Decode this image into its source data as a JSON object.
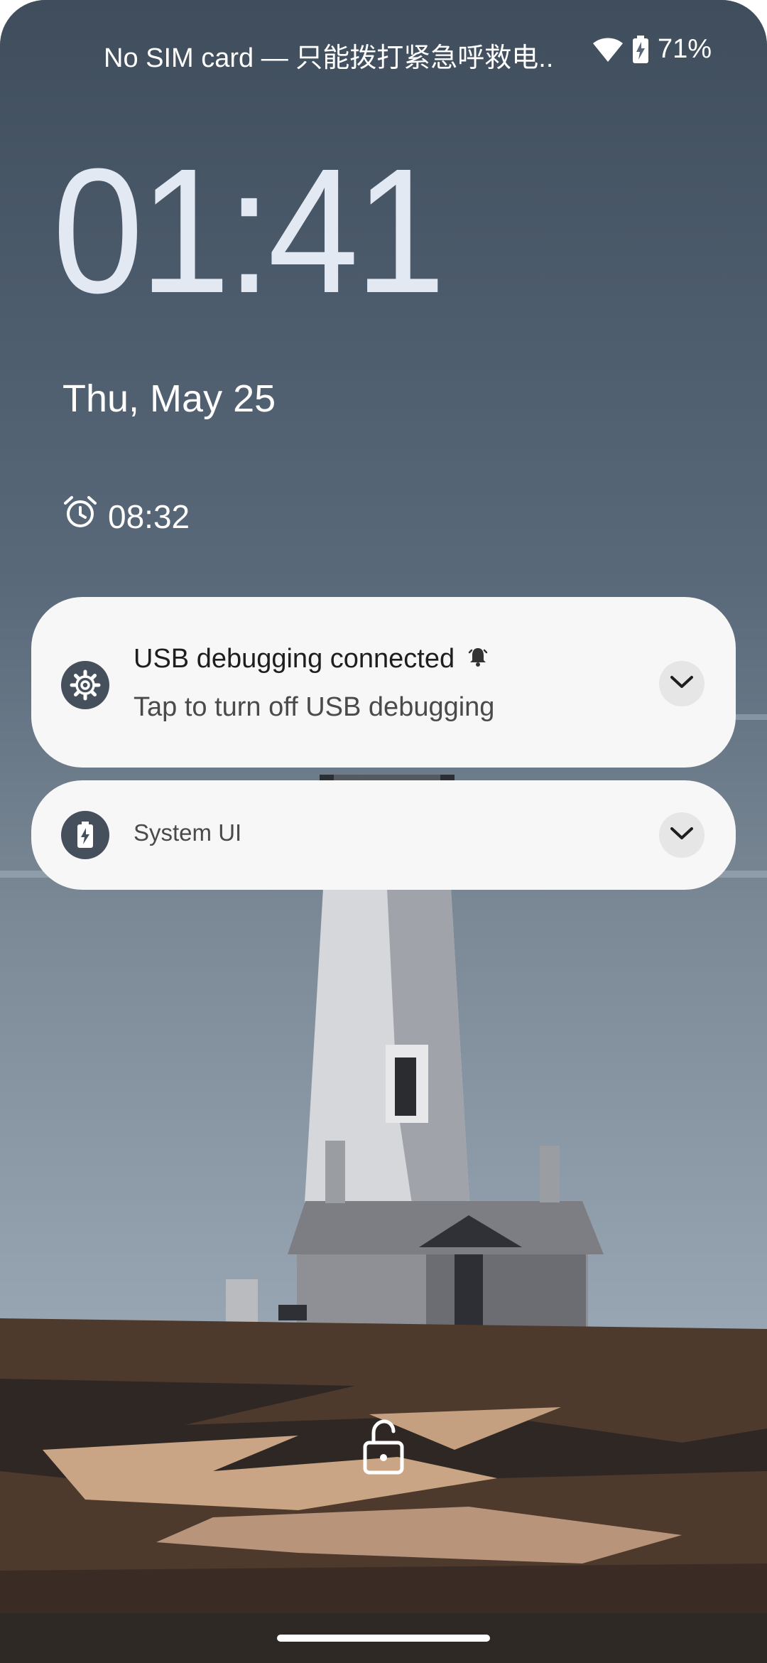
{
  "status_bar": {
    "carrier_text": "No SIM card — 只能拨打紧急呼救电..",
    "battery_percent": "71%",
    "icons": [
      "wifi-icon",
      "battery-charging-icon"
    ]
  },
  "lockscreen": {
    "time": "01:41",
    "date": "Thu, May 25",
    "alarm_time": "08:32",
    "alarm_icon": "alarm-clock-icon"
  },
  "notifications": [
    {
      "app_icon": "settings-gear-icon",
      "title": "USB debugging connected",
      "text": "Tap to turn off USB debugging",
      "alert_icon": "bell-icon"
    },
    {
      "app_icon": "battery-charging-icon",
      "app_name": "System UI"
    }
  ],
  "bottom": {
    "lock_icon": "unlocked-padlock-icon"
  },
  "colors": {
    "card_bg": "#f7f7f7",
    "icon_circle": "#46505c",
    "clock_text": "#e3e9f3"
  }
}
